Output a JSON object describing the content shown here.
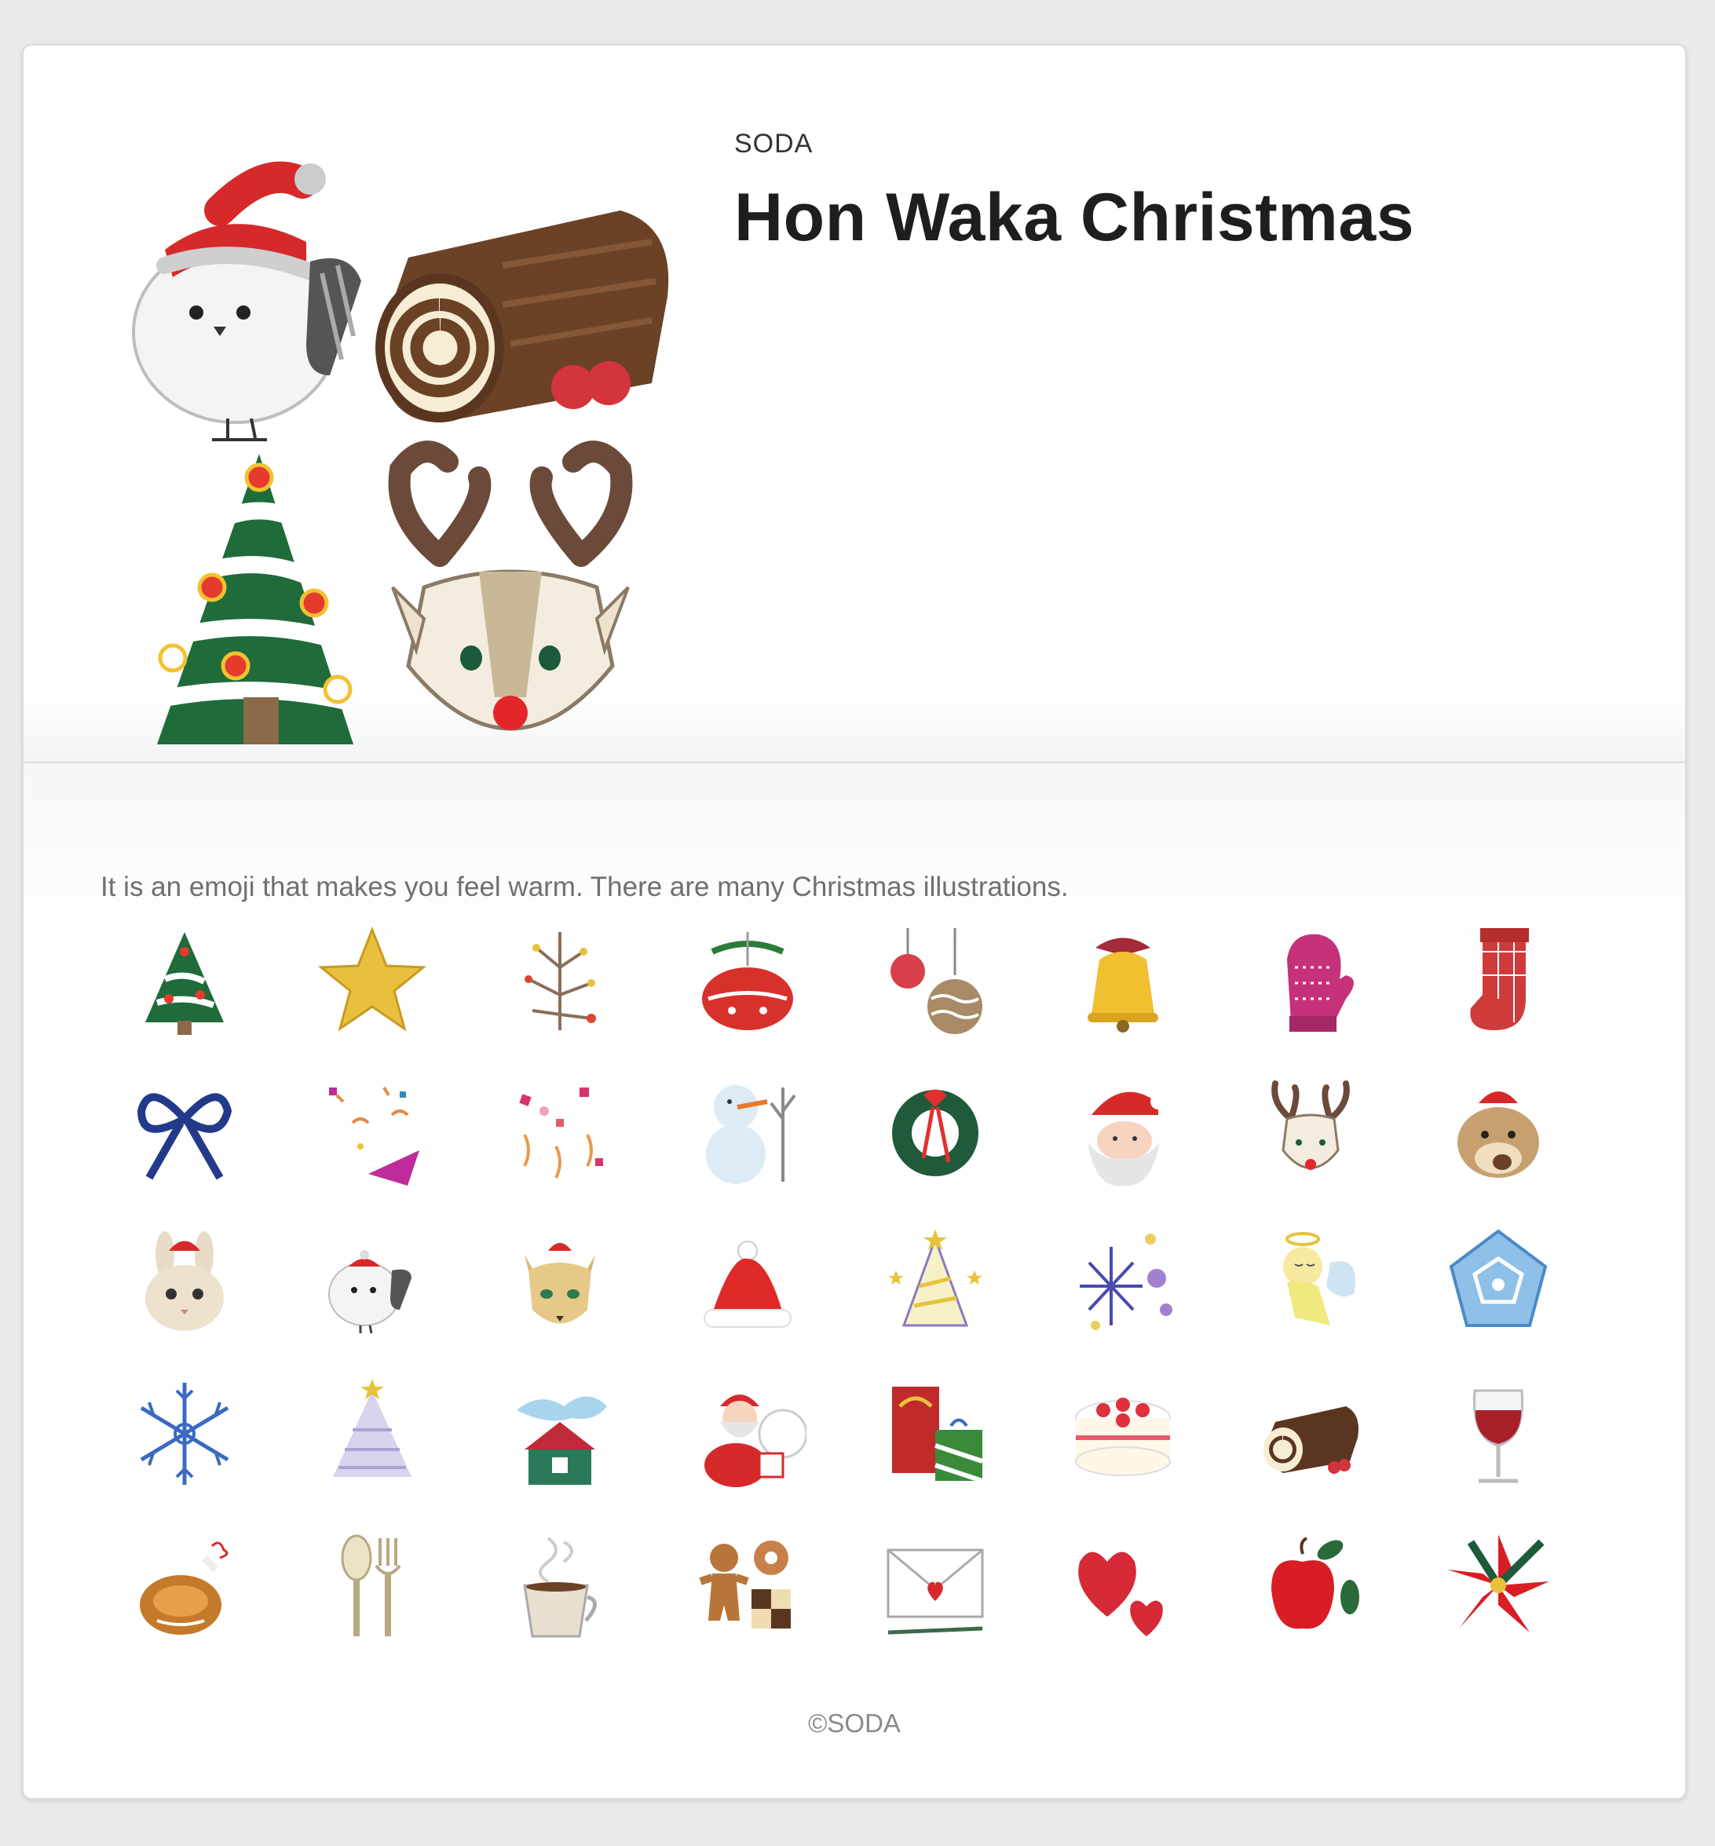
{
  "sticker": {
    "author": "SODA",
    "title": "Hon Waka Christmas",
    "description": "It is an emoji that makes you feel warm. There are many Christmas illustrations.",
    "copyright": "©SODA"
  },
  "main_art": [
    "snow-bird-santa-hat-icon",
    "yule-log-cake-icon",
    "snowy-christmas-tree-icon",
    "reindeer-face-icon"
  ],
  "emojis": [
    {
      "name": "christmas-tree-icon"
    },
    {
      "name": "gold-star-icon"
    },
    {
      "name": "berry-twig-icon"
    },
    {
      "name": "red-ornament-bow-icon"
    },
    {
      "name": "hanging-ornaments-icon"
    },
    {
      "name": "golden-bell-icon"
    },
    {
      "name": "knit-mitten-icon"
    },
    {
      "name": "christmas-stocking-icon"
    },
    {
      "name": "blue-ribbon-icon"
    },
    {
      "name": "party-popper-icon"
    },
    {
      "name": "confetti-icon"
    },
    {
      "name": "snowman-icon"
    },
    {
      "name": "wreath-icon"
    },
    {
      "name": "santa-face-icon"
    },
    {
      "name": "reindeer-icon"
    },
    {
      "name": "chipmunk-santa-hat-icon"
    },
    {
      "name": "bunny-santa-hat-icon"
    },
    {
      "name": "snow-bird-icon"
    },
    {
      "name": "fox-santa-hat-icon"
    },
    {
      "name": "santa-hat-icon"
    },
    {
      "name": "party-hat-stars-icon"
    },
    {
      "name": "sparkle-dots-icon"
    },
    {
      "name": "angel-icon"
    },
    {
      "name": "ice-crystal-icon"
    },
    {
      "name": "snowflake-icon"
    },
    {
      "name": "frosted-tree-icon"
    },
    {
      "name": "snowy-house-icon"
    },
    {
      "name": "santa-with-sack-icon"
    },
    {
      "name": "gift-boxes-icon"
    },
    {
      "name": "strawberry-cake-icon"
    },
    {
      "name": "yule-log-icon"
    },
    {
      "name": "wine-glass-icon"
    },
    {
      "name": "roast-chicken-icon"
    },
    {
      "name": "spoon-fork-icon"
    },
    {
      "name": "coffee-cup-icon"
    },
    {
      "name": "gingerbread-cookies-icon"
    },
    {
      "name": "love-letter-icon"
    },
    {
      "name": "hearts-icon"
    },
    {
      "name": "red-apple-icon"
    },
    {
      "name": "poinsettia-icon"
    }
  ]
}
